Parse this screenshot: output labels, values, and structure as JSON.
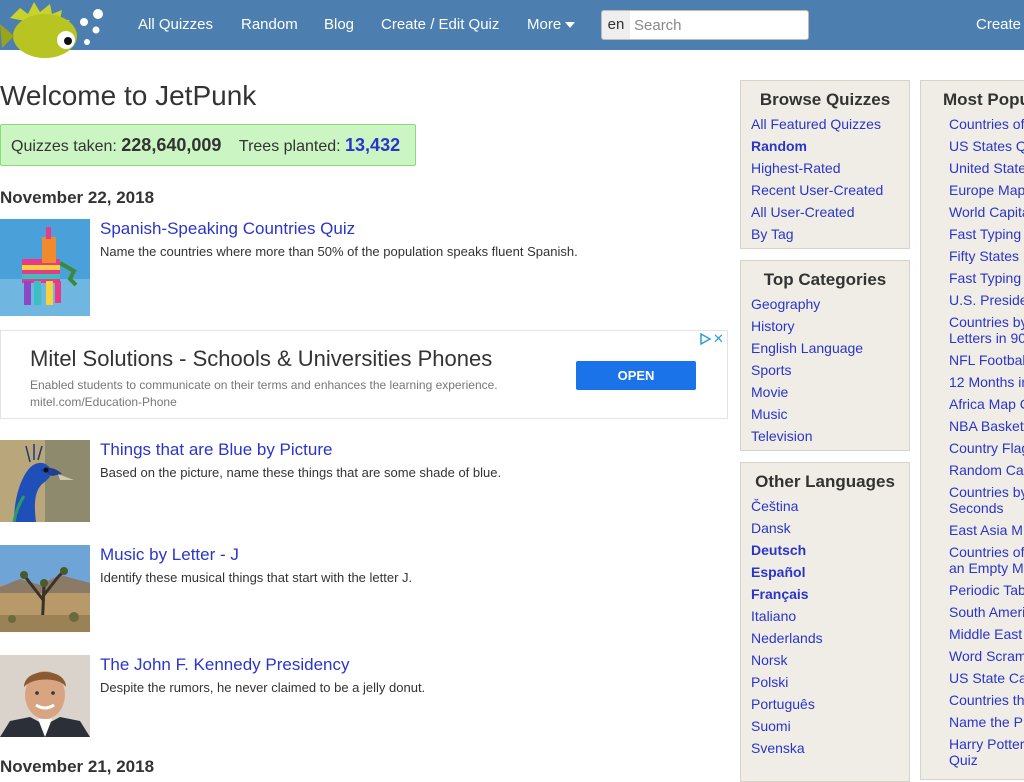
{
  "nav": {
    "items": [
      "All Quizzes",
      "Random",
      "Blog",
      "Create / Edit Quiz",
      "More"
    ],
    "lang": "en",
    "search_placeholder": "Search",
    "create": "Create"
  },
  "main": {
    "welcome": "Welcome to JetPunk",
    "stats": {
      "quizzes_label": "Quizzes taken:",
      "quizzes_value": "228,640,009",
      "trees_label": "Trees planted:",
      "trees_value": "13,432"
    },
    "date1": "November 22, 2018",
    "date2": "November 21, 2018",
    "quizzes": [
      {
        "title": "Spanish-Speaking Countries Quiz",
        "desc": "Name the countries where more than 50% of the population speaks fluent Spanish."
      },
      {
        "title": "Things that are Blue by Picture",
        "desc": "Based on the picture, name these things that are some shade of blue."
      },
      {
        "title": "Music by Letter - J",
        "desc": "Identify these musical things that start with the letter J."
      },
      {
        "title": "The John F. Kennedy Presidency",
        "desc": "Despite the rumors, he never claimed to be a jelly donut."
      }
    ]
  },
  "ad": {
    "title": "Mitel Solutions - Schools & Universities Phones",
    "desc": "Enabled students to communicate on their terms and enhances the learning experience.",
    "url": "mitel.com/Education-Phone",
    "button": "OPEN",
    "close": "✕"
  },
  "sidebar": {
    "browse": {
      "title": "Browse Quizzes",
      "links": [
        "All Featured Quizzes",
        "Random",
        "Highest-Rated",
        "Recent User-Created",
        "All User-Created",
        "By Tag"
      ]
    },
    "categories": {
      "title": "Top Categories",
      "links": [
        "Geography",
        "History",
        "English Language",
        "Sports",
        "Movie",
        "Music",
        "Television"
      ]
    },
    "languages": {
      "title": "Other Languages",
      "links": [
        "Čeština",
        "Dansk",
        "Deutsch",
        "Español",
        "Français",
        "Italiano",
        "Nederlands",
        "Norsk",
        "Polski",
        "Português",
        "Suomi",
        "Svenska"
      ]
    },
    "popular": {
      "title": "Most Popu",
      "links": [
        "Countries of",
        "US States Q",
        "United State",
        "Europe Map",
        "World Capita",
        "Fast Typing",
        "Fifty States",
        "Fast Typing",
        "U.S. Preside",
        "Countries by",
        "Letters in 90",
        "NFL Footbal",
        "12 Months ir",
        "Africa Map C",
        "NBA Basket",
        "Country Flag",
        "Random Ca",
        "Countries by",
        "Seconds",
        "East Asia M",
        "Countries of",
        "an Empty M",
        "Periodic Tab",
        "South Ameri",
        "Middle East",
        "Word Scram",
        "US State Ca",
        "Countries th",
        "Name the P",
        "Harry Potter",
        "Quiz"
      ]
    }
  },
  "colors": {
    "topbar": "#4c7fb0",
    "link": "#2a35c9",
    "stats_bg": "#ccf5c4",
    "sidebar_bg": "#f0ede6",
    "ad_button": "#1a73e8"
  }
}
